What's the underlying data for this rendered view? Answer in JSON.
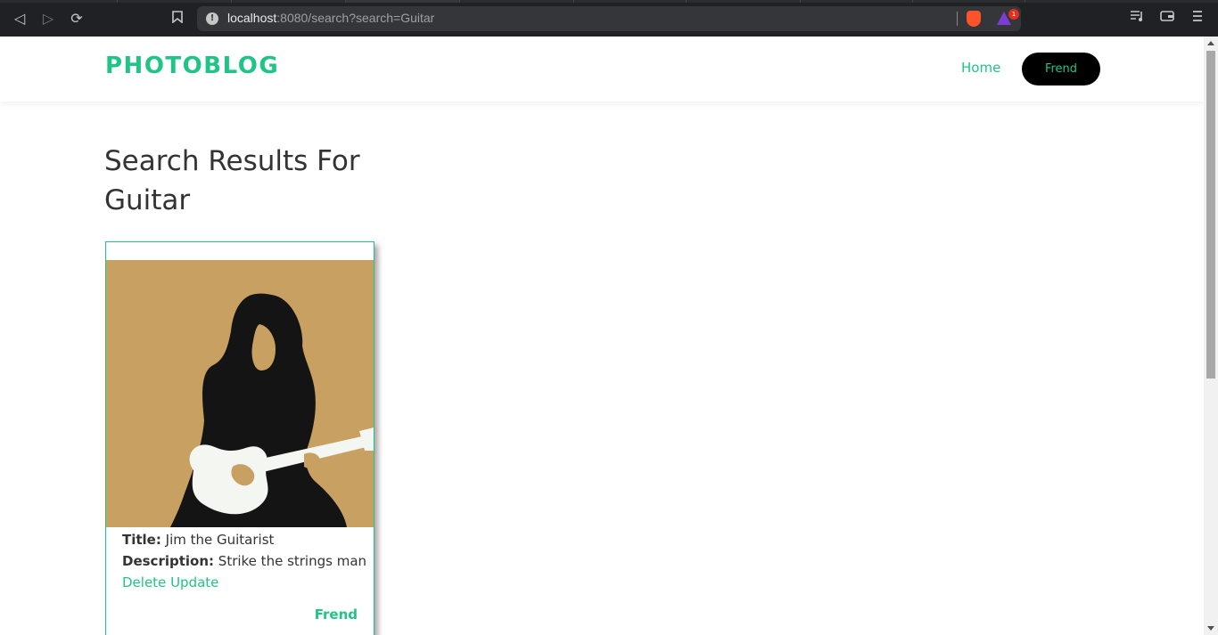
{
  "browser": {
    "url_host": "localhost",
    "url_rest": ":8080/search?search=Guitar",
    "rewards_badge": "1"
  },
  "navbar": {
    "brand": "PHOTOBLOG",
    "home_label": "Home",
    "user_label": "Frend"
  },
  "search": {
    "heading": "Search Results For Guitar"
  },
  "results": [
    {
      "title_label": "Title:",
      "title": "Jim the Guitarist",
      "description_label": "Description:",
      "description": "Strike the strings man",
      "delete_label": "Delete",
      "update_label": "Update",
      "author": "Frend"
    }
  ],
  "colors": {
    "accent": "#20c486",
    "photo_background": "#c8a062"
  }
}
